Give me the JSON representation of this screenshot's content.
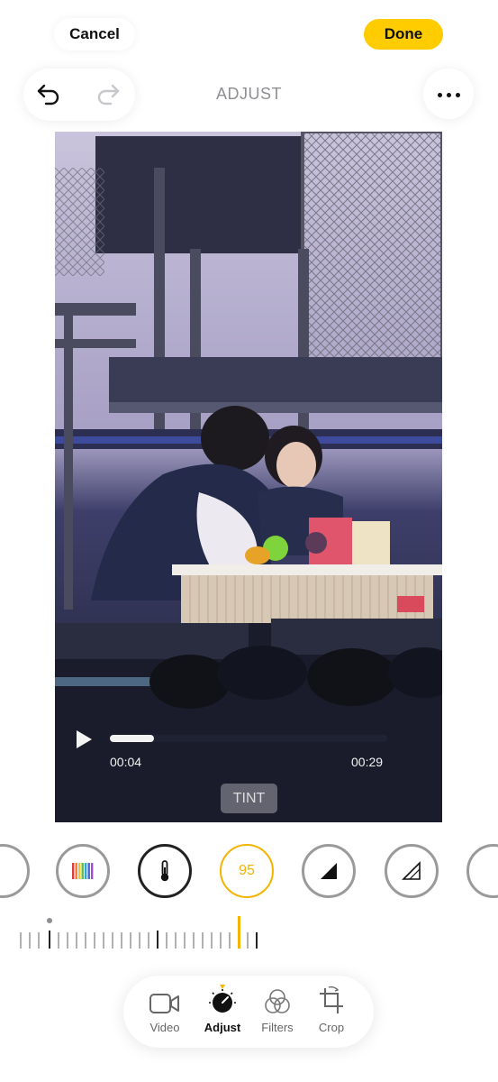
{
  "header": {
    "cancel_label": "Cancel",
    "done_label": "Done",
    "title": "ADJUST"
  },
  "player": {
    "current_time": "00:04",
    "end_time": "00:29",
    "progress": 0.16,
    "adjustment_badge": "TINT"
  },
  "tools": {
    "active_value": "95",
    "items": [
      "vibrance-icon",
      "warmth-icon",
      "tint-value",
      "sharpness-icon",
      "definition-icon"
    ]
  },
  "tabs": [
    {
      "label": "Video"
    },
    {
      "label": "Adjust"
    },
    {
      "label": "Filters"
    },
    {
      "label": "Crop"
    }
  ],
  "colors": {
    "accent": "#ffcc00",
    "active_ring": "#f5b400"
  }
}
